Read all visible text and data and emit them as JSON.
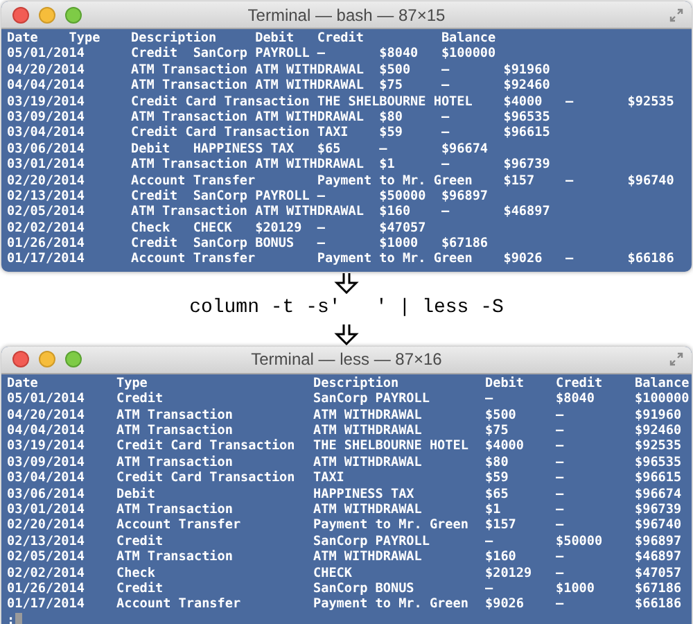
{
  "top_window": {
    "title": "Terminal — bash — 87×15",
    "lines": [
      "Date    Type    Description     Debit   Credit          Balance",
      "05/01/2014      Credit  SanCorp PAYROLL –       $8040   $100000",
      "04/20/2014      ATM Transaction ATM WITHDRAWAL  $500    –       $91960",
      "04/04/2014      ATM Transaction ATM WITHDRAWAL  $75     –       $92460",
      "03/19/2014      Credit Card Transaction THE SHELBOURNE HOTEL    $4000   –       $92535",
      "03/09/2014      ATM Transaction ATM WITHDRAWAL  $80     –       $96535",
      "03/04/2014      Credit Card Transaction TAXI    $59     –       $96615",
      "03/06/2014      Debit   HAPPINESS TAX   $65     –       $96674",
      "03/01/2014      ATM Transaction ATM WITHDRAWAL  $1      –       $96739",
      "02/20/2014      Account Transfer        Payment to Mr. Green    $157    –       $96740",
      "02/13/2014      Credit  SanCorp PAYROLL –       $50000  $96897",
      "02/05/2014      ATM Transaction ATM WITHDRAWAL  $160    –       $46897",
      "02/02/2014      Check   CHECK   $20129  –       $47057",
      "01/26/2014      Credit  SanCorp BONUS   –       $1000   $67186",
      "01/17/2014      Account Transfer        Payment to Mr. Green    $9026   –       $66186"
    ]
  },
  "command": "column -t -s'   ' | less -S",
  "bottom_window": {
    "title": "Terminal — less — 87×16",
    "columns": [
      "Date",
      "Type",
      "Description",
      "Debit",
      "Credit",
      "Balance"
    ],
    "rows": [
      [
        "05/01/2014",
        "Credit",
        "SanCorp PAYROLL",
        "–",
        "$8040",
        "$100000"
      ],
      [
        "04/20/2014",
        "ATM Transaction",
        "ATM WITHDRAWAL",
        "$500",
        "–",
        "$91960"
      ],
      [
        "04/04/2014",
        "ATM Transaction",
        "ATM WITHDRAWAL",
        "$75",
        "–",
        "$92460"
      ],
      [
        "03/19/2014",
        "Credit Card Transaction",
        "THE SHELBOURNE HOTEL",
        "$4000",
        "–",
        "$92535"
      ],
      [
        "03/09/2014",
        "ATM Transaction",
        "ATM WITHDRAWAL",
        "$80",
        "–",
        "$96535"
      ],
      [
        "03/04/2014",
        "Credit Card Transaction",
        "TAXI",
        "$59",
        "–",
        "$96615"
      ],
      [
        "03/06/2014",
        "Debit",
        "HAPPINESS TAX",
        "$65",
        "–",
        "$96674"
      ],
      [
        "03/01/2014",
        "ATM Transaction",
        "ATM WITHDRAWAL",
        "$1",
        "–",
        "$96739"
      ],
      [
        "02/20/2014",
        "Account Transfer",
        "Payment to Mr. Green",
        "$157",
        "–",
        "$96740"
      ],
      [
        "02/13/2014",
        "Credit",
        "SanCorp PAYROLL",
        "–",
        "$50000",
        "$96897"
      ],
      [
        "02/05/2014",
        "ATM Transaction",
        "ATM WITHDRAWAL",
        "$160",
        "–",
        "$46897"
      ],
      [
        "02/02/2014",
        "Check",
        "CHECK",
        "$20129",
        "–",
        "$47057"
      ],
      [
        "01/26/2014",
        "Credit",
        "SanCorp BONUS",
        "–",
        "$1000",
        "$67186"
      ],
      [
        "01/17/2014",
        "Account Transfer",
        "Payment to Mr. Green",
        "$9026",
        "–",
        "$66186"
      ]
    ],
    "prompt": ":"
  }
}
